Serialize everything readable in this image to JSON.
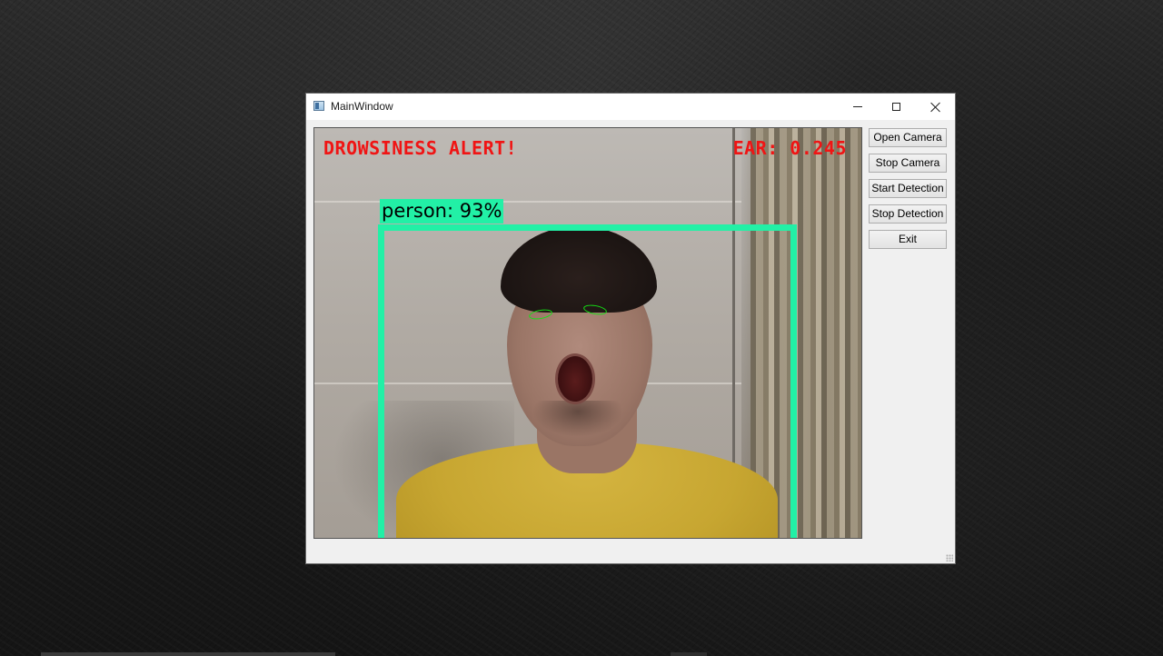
{
  "window": {
    "title": "MainWindow",
    "icon": "app-window-icon",
    "controls": {
      "minimize": "minimize-icon",
      "maximize": "maximize-icon",
      "close": "close-icon"
    }
  },
  "video": {
    "alert_text": "DROWSINESS ALERT!",
    "ear_text": "EAR: 0.245",
    "detection_label": "person: 93%",
    "alert_color": "#f01414",
    "bbox_color": "#22f0a6",
    "eye_contour_color": "#14e014"
  },
  "buttons": {
    "open_camera": "Open Camera",
    "stop_camera": "Stop Camera",
    "start_detection": "Start Detection",
    "stop_detection": "Stop Detection",
    "exit": "Exit"
  }
}
